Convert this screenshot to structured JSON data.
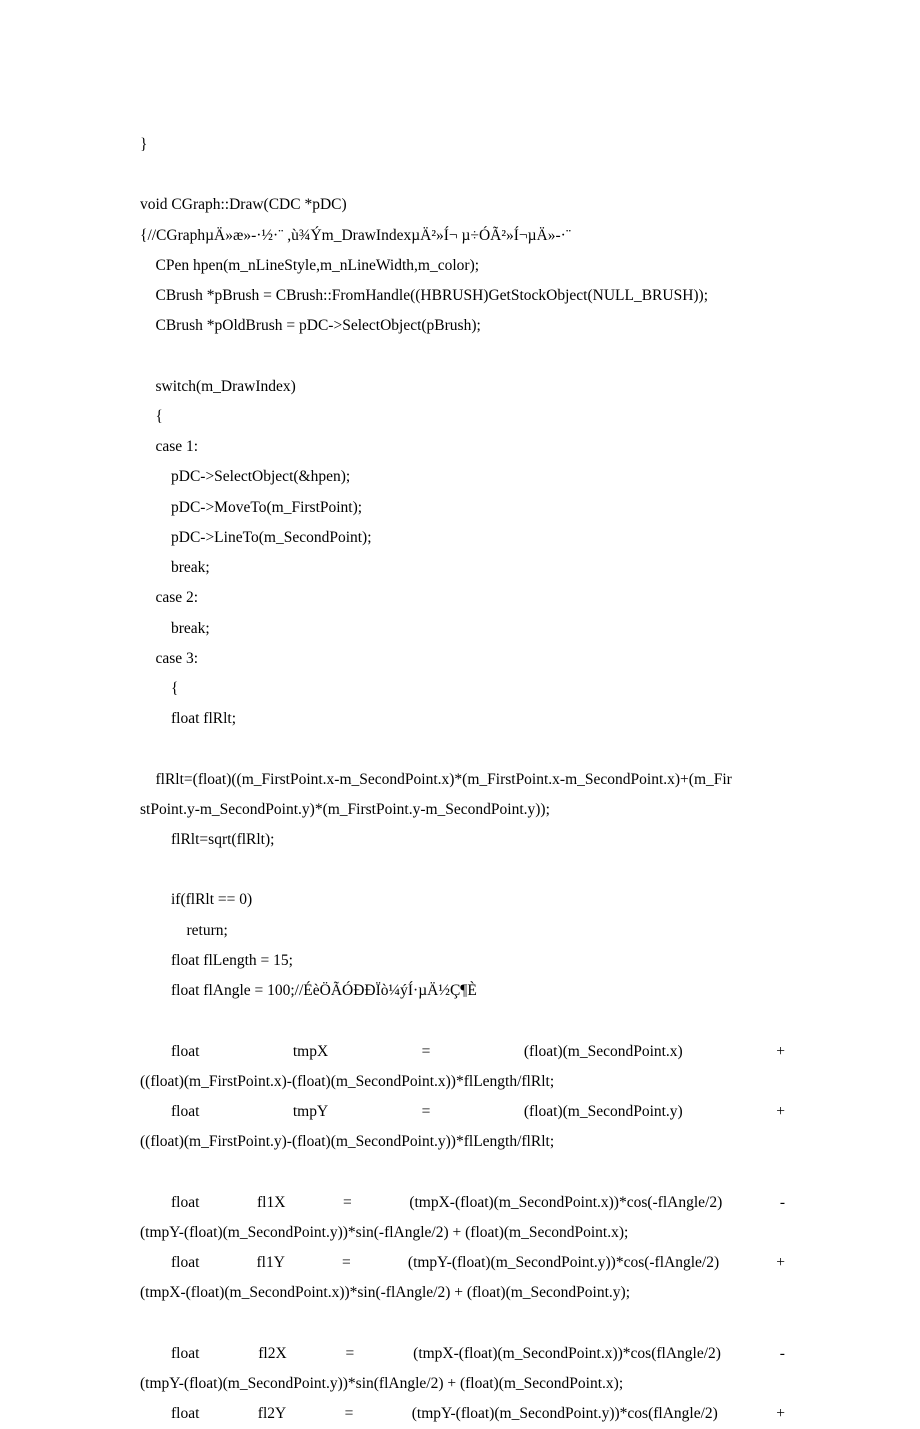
{
  "lines": [
    {
      "type": "plain",
      "text": "}",
      "indent": 0
    },
    {
      "type": "plain",
      "text": "",
      "indent": 0
    },
    {
      "type": "plain",
      "text": "void CGraph::Draw(CDC *pDC)",
      "indent": 0
    },
    {
      "type": "plain",
      "text": "{//CGraphµÄ»æ»-·½·¨ ,ù¾Ým_DrawIndexµÄ²»Í¬ µ÷ÓÃ²»Í¬µÄ»-·¨",
      "indent": 0
    },
    {
      "type": "plain",
      "text": "CPen hpen(m_nLineStyle,m_nLineWidth,m_color);",
      "indent": 1
    },
    {
      "type": "plain",
      "text": "CBrush *pBrush = CBrush::FromHandle((HBRUSH)GetStockObject(NULL_BRUSH));",
      "indent": 1
    },
    {
      "type": "plain",
      "text": "CBrush *pOldBrush = pDC->SelectObject(pBrush);",
      "indent": 1
    },
    {
      "type": "plain",
      "text": "",
      "indent": 0
    },
    {
      "type": "plain",
      "text": "switch(m_DrawIndex)",
      "indent": 1
    },
    {
      "type": "plain",
      "text": "{",
      "indent": 1
    },
    {
      "type": "plain",
      "text": "case 1:",
      "indent": 1
    },
    {
      "type": "plain",
      "text": "pDC->SelectObject(&hpen);",
      "indent": 2
    },
    {
      "type": "plain",
      "text": "pDC->MoveTo(m_FirstPoint);",
      "indent": 2
    },
    {
      "type": "plain",
      "text": "pDC->LineTo(m_SecondPoint);",
      "indent": 2
    },
    {
      "type": "plain",
      "text": "break;",
      "indent": 2
    },
    {
      "type": "plain",
      "text": "case 2:",
      "indent": 1
    },
    {
      "type": "plain",
      "text": "break;",
      "indent": 2
    },
    {
      "type": "plain",
      "text": "case 3:",
      "indent": 1
    },
    {
      "type": "plain",
      "text": "{",
      "indent": 2
    },
    {
      "type": "plain",
      "text": "float flRlt;",
      "indent": 2
    },
    {
      "type": "plain",
      "text": "",
      "indent": 0
    },
    {
      "type": "plain",
      "text": "flRlt=(float)((m_FirstPoint.x-m_SecondPoint.x)*(m_FirstPoint.x-m_SecondPoint.x)+(m_Fir",
      "indent": 1
    },
    {
      "type": "plain",
      "text": "stPoint.y-m_SecondPoint.y)*(m_FirstPoint.y-m_SecondPoint.y));",
      "indent": 0
    },
    {
      "type": "plain",
      "text": "flRlt=sqrt(flRlt);",
      "indent": 2
    },
    {
      "type": "plain",
      "text": "",
      "indent": 0
    },
    {
      "type": "plain",
      "text": "if(flRlt == 0)",
      "indent": 2
    },
    {
      "type": "plain",
      "text": "return;",
      "indent": 3
    },
    {
      "type": "plain",
      "text": "float flLength = 15;",
      "indent": 2
    },
    {
      "type": "plain",
      "text": "float flAngle = 100;//ÉèÖÃÓÐÐÏò¼ýÍ·µÄ½Ç¶È",
      "indent": 2
    },
    {
      "type": "plain",
      "text": "",
      "indent": 0
    },
    {
      "type": "justify",
      "tokens": [
        "        float",
        "tmpX",
        "=",
        "(float)(m_SecondPoint.x)",
        "+"
      ]
    },
    {
      "type": "plain",
      "text": "((float)(m_FirstPoint.x)-(float)(m_SecondPoint.x))*flLength/flRlt;",
      "indent": 0
    },
    {
      "type": "justify",
      "tokens": [
        "        float",
        "tmpY",
        "=",
        "(float)(m_SecondPoint.y)",
        "+"
      ]
    },
    {
      "type": "plain",
      "text": "((float)(m_FirstPoint.y)-(float)(m_SecondPoint.y))*flLength/flRlt;",
      "indent": 0
    },
    {
      "type": "plain",
      "text": "",
      "indent": 0
    },
    {
      "type": "justify",
      "tokens": [
        "        float",
        "fl1X",
        "=",
        "(tmpX-(float)(m_SecondPoint.x))*cos(-flAngle/2)",
        "-"
      ]
    },
    {
      "type": "plain",
      "text": "(tmpY-(float)(m_SecondPoint.y))*sin(-flAngle/2) + (float)(m_SecondPoint.x);",
      "indent": 0
    },
    {
      "type": "justify",
      "tokens": [
        "        float",
        "fl1Y",
        "=",
        "(tmpY-(float)(m_SecondPoint.y))*cos(-flAngle/2)",
        "+"
      ]
    },
    {
      "type": "plain",
      "text": "(tmpX-(float)(m_SecondPoint.x))*sin(-flAngle/2) + (float)(m_SecondPoint.y);",
      "indent": 0
    },
    {
      "type": "plain",
      "text": "",
      "indent": 0
    },
    {
      "type": "justify",
      "tokens": [
        "        float",
        "fl2X",
        "=",
        "(tmpX-(float)(m_SecondPoint.x))*cos(flAngle/2)",
        "-"
      ]
    },
    {
      "type": "plain",
      "text": "(tmpY-(float)(m_SecondPoint.y))*sin(flAngle/2) + (float)(m_SecondPoint.x);",
      "indent": 0
    },
    {
      "type": "justify",
      "tokens": [
        "        float",
        "fl2Y",
        "=",
        "(tmpY-(float)(m_SecondPoint.y))*cos(flAngle/2)",
        "+"
      ]
    }
  ],
  "indent_unit": "    "
}
